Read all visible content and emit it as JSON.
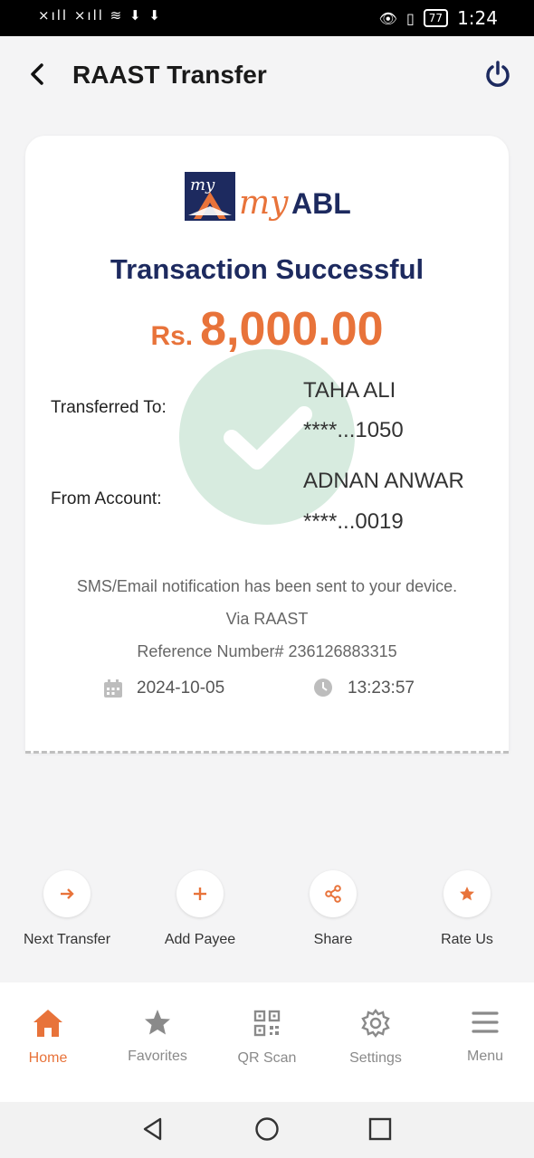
{
  "status_bar": {
    "left_icons": "×ıll ×ıll ≋ ⬇ ⬇",
    "battery": "77",
    "time": "1:24"
  },
  "header": {
    "title": "RAAST Transfer",
    "back_icon": "chevron-left-icon",
    "power_icon": "power-icon"
  },
  "card": {
    "logo_text": "myABL",
    "status_title": "Transaction Successful",
    "currency": "Rs.",
    "amount": "8,000.00",
    "transferred_to_label": "Transferred To:",
    "to_name": "TAHA ALI",
    "to_account": "****...1050",
    "from_account_label": "From Account:",
    "from_name": "ADNAN ANWAR",
    "from_account": "****...0019",
    "notification": "SMS/Email notification has been sent to your device.",
    "via": "Via RAAST",
    "reference": "Reference Number# 236126883315",
    "date": "2024-10-05",
    "time": "13:23:57"
  },
  "actions": [
    {
      "label": "Next Transfer",
      "icon": "arrow-right-icon"
    },
    {
      "label": "Add Payee",
      "icon": "plus-icon"
    },
    {
      "label": "Share",
      "icon": "share-icon"
    },
    {
      "label": "Rate Us",
      "icon": "star-icon"
    }
  ],
  "bottom_nav": [
    {
      "label": "Home",
      "icon": "home-icon",
      "active": true
    },
    {
      "label": "Favorites",
      "icon": "star-icon"
    },
    {
      "label": "QR Scan",
      "icon": "qr-icon"
    },
    {
      "label": "Settings",
      "icon": "gear-icon"
    },
    {
      "label": "Menu",
      "icon": "menu-icon"
    }
  ],
  "colors": {
    "accent": "#e8733a",
    "navy": "#1d2a5f",
    "success_circle": "#d7ebdf"
  }
}
